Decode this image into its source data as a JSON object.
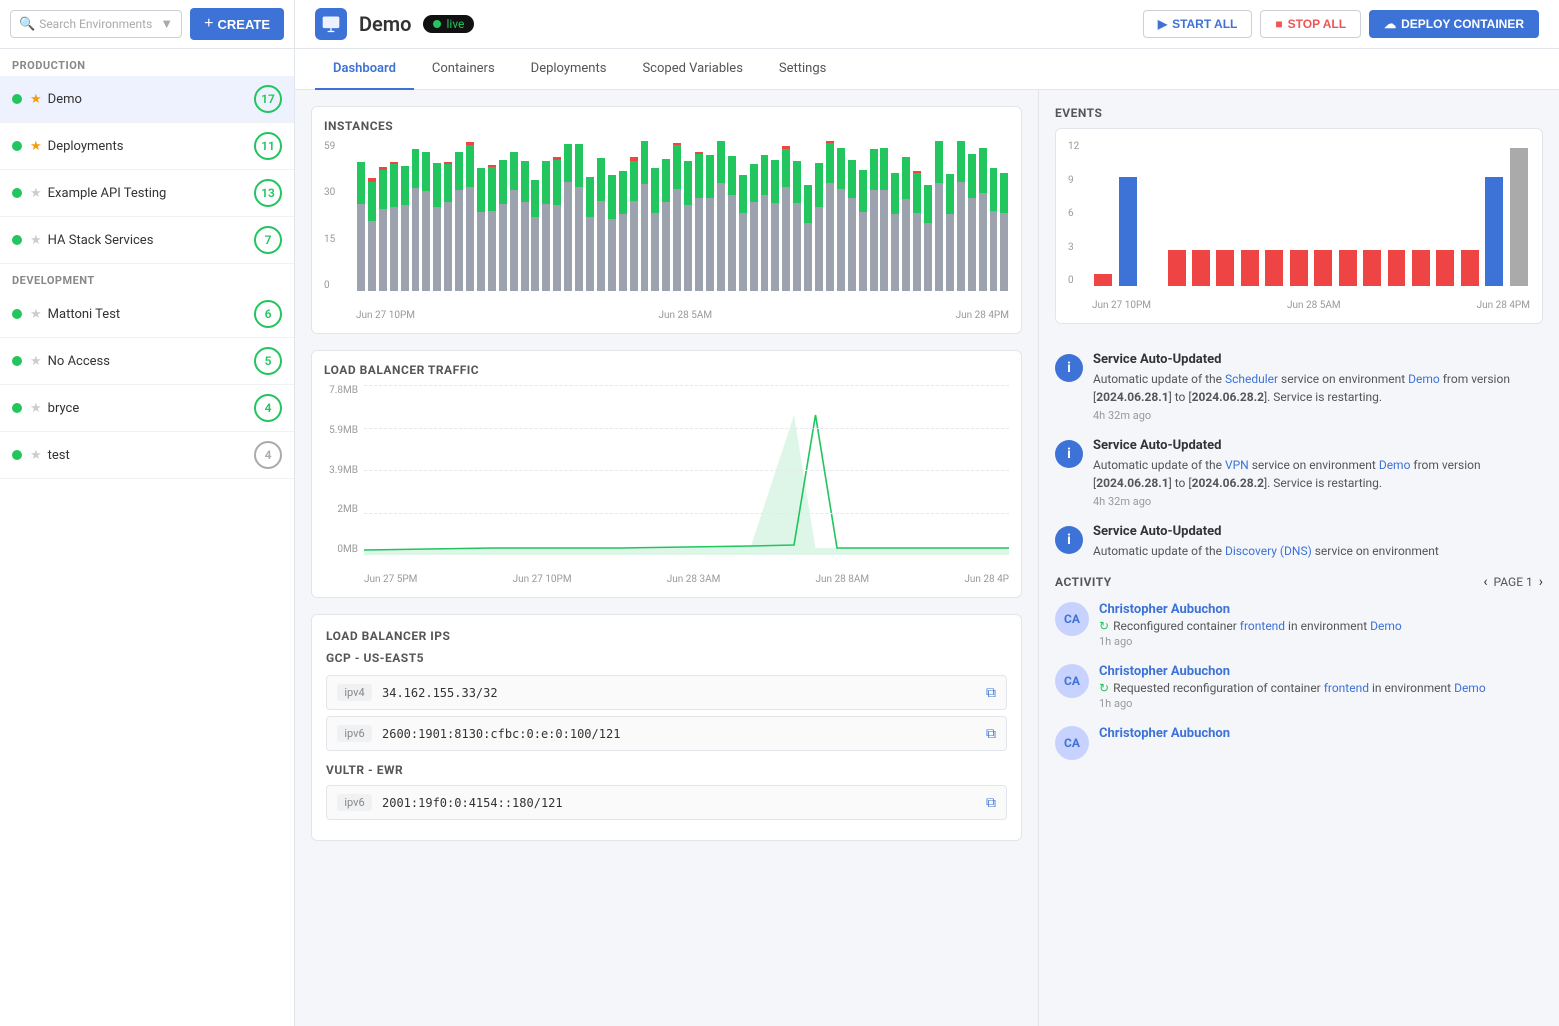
{
  "sidebar": {
    "search_placeholder": "Search Environments",
    "create_label": "CREATE",
    "sections": [
      {
        "label": "PRODUCTION",
        "items": [
          {
            "name": "Demo",
            "status": "green",
            "star": true,
            "badge": "17",
            "badge_color": "green",
            "active": true
          },
          {
            "name": "Deployments",
            "status": "green",
            "star": true,
            "badge": "11",
            "badge_color": "green",
            "active": false
          },
          {
            "name": "Example API Testing",
            "status": "green",
            "star": false,
            "badge": "13",
            "badge_color": "green",
            "active": false
          },
          {
            "name": "HA Stack Services",
            "status": "green",
            "star": false,
            "badge": "7",
            "badge_color": "green",
            "active": false
          }
        ]
      },
      {
        "label": "DEVELOPMENT",
        "items": [
          {
            "name": "Mattoni Test",
            "status": "green",
            "star": false,
            "badge": "6",
            "badge_color": "green",
            "active": false
          },
          {
            "name": "No Access",
            "status": "green",
            "star": false,
            "badge": "5",
            "badge_color": "green",
            "active": false
          },
          {
            "name": "bryce",
            "status": "green",
            "star": false,
            "badge": "4",
            "badge_color": "green",
            "active": false
          },
          {
            "name": "test",
            "status": "green",
            "star": false,
            "badge": "4",
            "badge_color": "gray",
            "active": false
          }
        ]
      }
    ]
  },
  "topbar": {
    "env_name": "Demo",
    "live_label": "live",
    "start_all": "START ALL",
    "stop_all": "STOP ALL",
    "deploy_container": "DEPLOY CONTAINER"
  },
  "tabs": [
    {
      "id": "dashboard",
      "label": "Dashboard",
      "active": true
    },
    {
      "id": "containers",
      "label": "Containers",
      "active": false
    },
    {
      "id": "deployments",
      "label": "Deployments",
      "active": false
    },
    {
      "id": "scoped_variables",
      "label": "Scoped Variables",
      "active": false
    },
    {
      "id": "settings",
      "label": "Settings",
      "active": false
    }
  ],
  "instances": {
    "title": "INSTANCES",
    "y_labels": [
      "59",
      "30",
      "15",
      "0"
    ],
    "x_labels": [
      "Jun 27 10PM",
      "Jun 28 5AM",
      "Jun 28 4PM"
    ]
  },
  "load_balancer_traffic": {
    "title": "LOAD BALANCER TRAFFIC",
    "y_labels": [
      "7.8MB",
      "5.9MB",
      "3.9MB",
      "2MB",
      "0MB"
    ],
    "x_labels": [
      "Jun 27 5PM",
      "Jun 27 10PM",
      "Jun 28 3AM",
      "Jun 28 8AM",
      "Jun 28 4P"
    ]
  },
  "load_balancer_ips": {
    "title": "LOAD BALANCER IPS",
    "providers": [
      {
        "name": "GCP - US-EAST5",
        "ips": [
          {
            "type": "ipv4",
            "value": "34.162.155.33/32"
          },
          {
            "type": "ipv6",
            "value": "2600:1901:8130:cfbc:0:e:0:100/121"
          }
        ]
      },
      {
        "name": "VULTR - EWR",
        "ips": [
          {
            "type": "ipv6",
            "value": "2001:19f0:0:4154::180/121"
          }
        ]
      }
    ]
  },
  "events": {
    "title": "EVENTS",
    "y_labels": [
      "12",
      "9",
      "6",
      "3",
      "0"
    ],
    "x_labels": [
      "Jun 27 10PM",
      "Jun 28 5AM",
      "Jun 28 4PM"
    ],
    "items": [
      {
        "title": "Service Auto-Updated",
        "desc_prefix": "Automatic update of the ",
        "service": "Scheduler",
        "desc_mid": " service on environment ",
        "env": "Demo",
        "desc_suffix": " from version [",
        "version_from": "2024.06.28.1",
        "desc_mid2": "] to [",
        "version_to": "2024.06.28.2",
        "desc_end": "]. Service is restarting.",
        "time": "4h 32m ago"
      },
      {
        "title": "Service Auto-Updated",
        "desc_prefix": "Automatic update of the ",
        "service": "VPN",
        "desc_mid": " service on environment ",
        "env": "Demo",
        "desc_suffix": " from version [",
        "version_from": "2024.06.28.1",
        "desc_mid2": "] to [",
        "version_to": "2024.06.28.2",
        "desc_end": "]. Service is restarting.",
        "time": "4h 32m ago"
      },
      {
        "title": "Service Auto-Updated",
        "desc_prefix": "Automatic update of the ",
        "service": "Discovery (DNS)",
        "desc_mid": " service on environment",
        "env": "",
        "desc_suffix": "",
        "version_from": "",
        "desc_mid2": "",
        "version_to": "",
        "desc_end": "",
        "time": ""
      }
    ]
  },
  "activity": {
    "title": "ACTIVITY",
    "page_label": "PAGE 1",
    "items": [
      {
        "user": "Christopher Aubuchon",
        "initials": "CA",
        "action_prefix": "Reconfigured container ",
        "link": "frontend",
        "action_suffix": " in environment ",
        "env": "Demo",
        "time": "1h ago"
      },
      {
        "user": "Christopher Aubuchon",
        "initials": "CA",
        "action_prefix": "Requested reconfiguration of container ",
        "link": "frontend",
        "action_suffix": " in environment ",
        "env": "Demo",
        "time": "1h ago"
      },
      {
        "user": "Christopher Aubuchon",
        "initials": "CA",
        "action_prefix": "",
        "link": "",
        "action_suffix": "",
        "env": "",
        "time": ""
      }
    ]
  }
}
